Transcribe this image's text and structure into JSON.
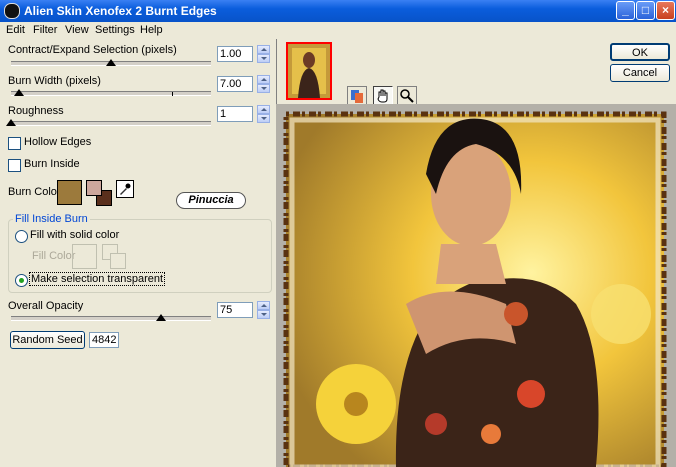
{
  "window": {
    "title": "Alien Skin Xenofex 2 Burnt Edges",
    "controls": [
      "minimize",
      "maximize",
      "close"
    ]
  },
  "menu": [
    "Edit",
    "Filter",
    "View",
    "Settings",
    "Help"
  ],
  "params": {
    "contract": {
      "label": "Contract/Expand Selection (pixels)",
      "value": "1.00",
      "slider_fraction": 0.5
    },
    "burn_width": {
      "label": "Burn Width (pixels)",
      "value": "7.00",
      "slider_fraction": 0.04
    },
    "roughness": {
      "label": "Roughness",
      "value": "1",
      "slider_fraction": 0.0
    },
    "opacity": {
      "label": "Overall Opacity",
      "value": "75",
      "slider_fraction": 0.75
    }
  },
  "options": {
    "hollow_edges": "Hollow Edges",
    "burn_inside": "Burn Inside",
    "burn_color_label": "Burn Color"
  },
  "colors": {
    "burn_color": "#9c7a3c",
    "swatch_front": "#cda79c",
    "swatch_back": "#5a2f1c"
  },
  "watermark": "Pinuccia",
  "fill_inside": {
    "title": "Fill Inside Burn",
    "solid": "Fill with solid color",
    "fill_color": "Fill Color",
    "transparent": "Make selection transparent"
  },
  "random_seed": {
    "button": "Random Seed",
    "value": "4842"
  },
  "buttons": {
    "ok": "OK",
    "cancel": "Cancel"
  },
  "tools": [
    "preview-compare-icon",
    "hand-icon",
    "zoom-icon"
  ]
}
